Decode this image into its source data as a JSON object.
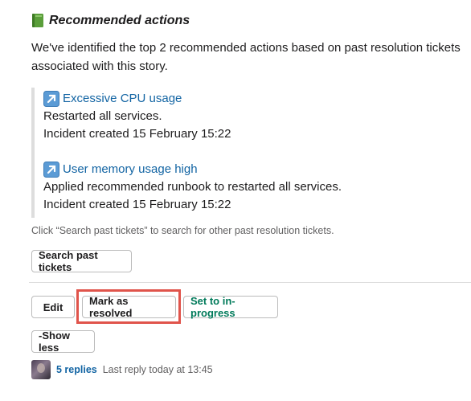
{
  "header": {
    "title": "Recommended actions",
    "icon": "green-book-icon"
  },
  "intro_text": "We've identified the top 2 recommended actions based on past resolution tickets associated with this story.",
  "actions": [
    {
      "link": "Excessive CPU usage",
      "description": "Restarted all services.",
      "incident": "Incident created 15 February 15:22",
      "icon": "arrow-up-right-icon"
    },
    {
      "link": "User memory usage high",
      "description": "Applied recommended runbook to restarted all services.",
      "incident": "Incident created 15 February 15:22",
      "icon": "arrow-up-right-icon"
    }
  ],
  "hint_text": "Click “Search past tickets” to search for other past resolution tickets.",
  "buttons": {
    "search": "Search past tickets",
    "edit": "Edit",
    "resolve": "Mark as resolved",
    "in_progress": "Set to in-progress",
    "show_less": "-Show less"
  },
  "thread": {
    "replies": "5 replies",
    "last_reply": "Last reply today at 13:45"
  },
  "colors": {
    "link": "#1264a3",
    "green_button_text": "#007a5a",
    "highlight_border": "#e0544b",
    "quote_bar": "#dddddd"
  }
}
